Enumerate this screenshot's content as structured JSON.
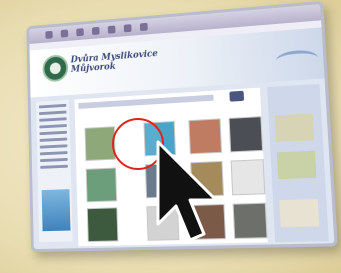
{
  "header": {
    "title_line1": "Dvůra Myslikovice",
    "title_line2": "Můjvorok"
  },
  "colors": {
    "highlight": "#e0231d",
    "cursor": "#111111"
  },
  "icons": [
    "logo-icon",
    "pointer-cursor-icon"
  ]
}
